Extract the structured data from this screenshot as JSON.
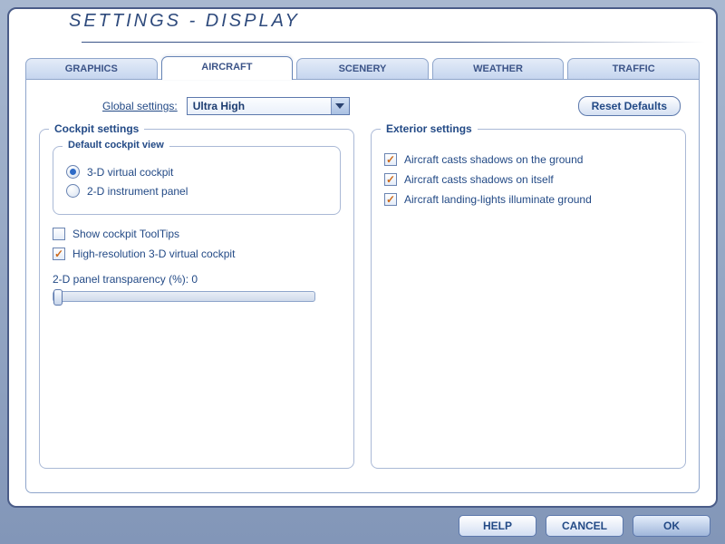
{
  "title": "SETTINGS - DISPLAY",
  "tabs": {
    "t0": "GRAPHICS",
    "t1": "AIRCRAFT",
    "t2": "SCENERY",
    "t3": "WEATHER",
    "t4": "TRAFFIC",
    "active": "t1"
  },
  "global": {
    "label": "Global settings:",
    "value": "Ultra High"
  },
  "buttons": {
    "reset": "Reset Defaults",
    "help": "HELP",
    "cancel": "CANCEL",
    "ok": "OK"
  },
  "cockpit": {
    "group_label": "Cockpit settings",
    "view_group_label": "Default cockpit view",
    "radio_3d": "3-D virtual cockpit",
    "radio_2d": "2-D instrument panel",
    "selected_view": "3d",
    "show_tooltips_label": "Show cockpit ToolTips",
    "show_tooltips": false,
    "hires_label": "High-resolution 3-D virtual cockpit",
    "hires": true,
    "slider_label_prefix": "2-D panel transparency (%): ",
    "slider_value": 0
  },
  "exterior": {
    "group_label": "Exterior settings",
    "opt1_label": "Aircraft casts shadows on the ground",
    "opt1": true,
    "opt2_label": "Aircraft casts shadows on itself",
    "opt2": true,
    "opt3_label": "Aircraft landing-lights illuminate ground",
    "opt3": true
  }
}
